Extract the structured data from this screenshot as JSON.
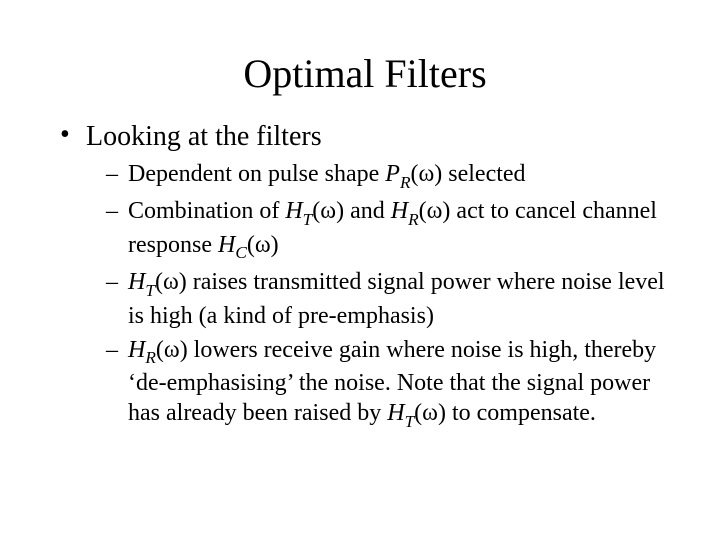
{
  "title": "Optimal Filters",
  "omega": "ω",
  "bullet1": {
    "lead": "Looking at the filters",
    "items": [
      {
        "pre": "Dependent on pulse shape ",
        "sym1": "P",
        "sub1": "R",
        "post": ") selected"
      },
      {
        "pre": "Combination of ",
        "sym1": "H",
        "sub1": "T",
        "mid1": ") and ",
        "sym2": "H",
        "sub2": "R",
        "mid2": ") act to cancel channel response ",
        "sym3": "H",
        "sub3": "C",
        "post": ")"
      },
      {
        "sym1": "H",
        "sub1": "T",
        "post": ") raises transmitted signal power where noise level is high (a kind of pre-emphasis)"
      },
      {
        "sym1": "H",
        "sub1": "R",
        "mid1": ") lowers receive gain where noise is high, thereby ‘de-emphasising’ the noise. Note that the signal power has already been raised by ",
        "sym2": "H",
        "sub2": "T",
        "post": ") to compensate."
      }
    ]
  }
}
